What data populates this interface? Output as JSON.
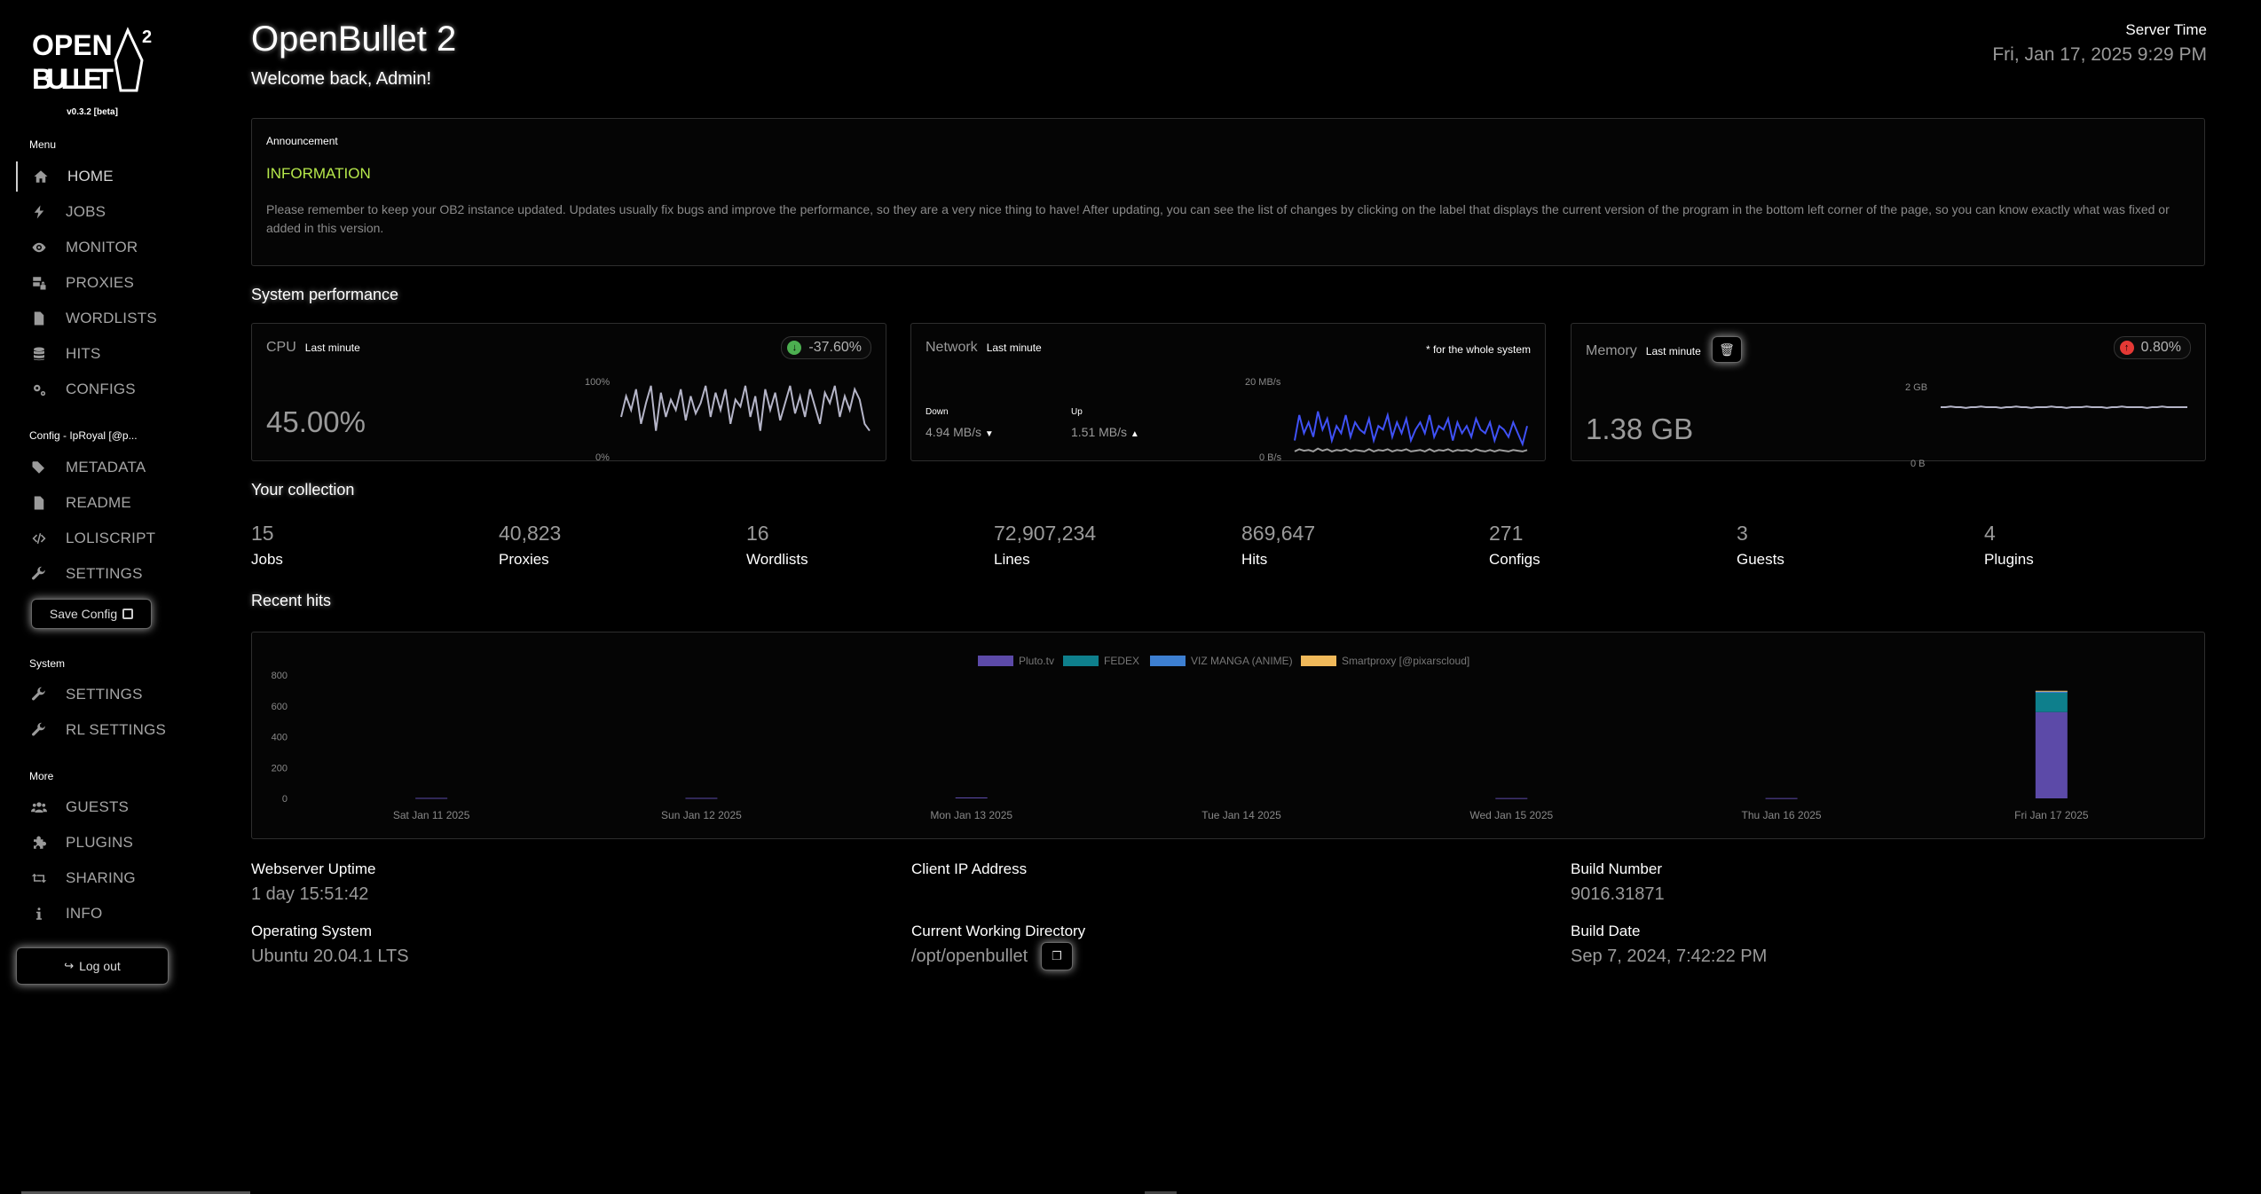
{
  "sidebar": {
    "logo_text": [
      "OPEN",
      "BULLET",
      "2"
    ],
    "version": "v0.3.2 [beta]",
    "menu_title": "Menu",
    "menu": [
      {
        "label": "HOME",
        "icon": "home-icon"
      },
      {
        "label": "JOBS",
        "icon": "bolt-icon"
      },
      {
        "label": "MONITOR",
        "icon": "eye-icon"
      },
      {
        "label": "PROXIES",
        "icon": "server-lock-icon"
      },
      {
        "label": "WORDLISTS",
        "icon": "file-icon"
      },
      {
        "label": "HITS",
        "icon": "database-icon"
      },
      {
        "label": "CONFIGS",
        "icon": "gears-icon"
      }
    ],
    "config_title": "Config - IpRoyal [@p...",
    "config_menu": [
      {
        "label": "METADATA",
        "icon": "tags-icon"
      },
      {
        "label": "README",
        "icon": "file-icon"
      },
      {
        "label": "LOLISCRIPT",
        "icon": "code-icon"
      },
      {
        "label": "SETTINGS",
        "icon": "wrench-icon"
      }
    ],
    "save_config": "Save Config",
    "system_title": "System",
    "system_menu": [
      {
        "label": "SETTINGS",
        "icon": "wrench-icon"
      },
      {
        "label": "RL SETTINGS",
        "icon": "wrench-icon"
      }
    ],
    "more_title": "More",
    "more_menu": [
      {
        "label": "GUESTS",
        "icon": "users-icon"
      },
      {
        "label": "PLUGINS",
        "icon": "puzzle-icon"
      },
      {
        "label": "SHARING",
        "icon": "retweet-icon"
      },
      {
        "label": "INFO",
        "icon": "info-icon"
      }
    ],
    "logout": "Log out"
  },
  "header": {
    "title": "OpenBullet 2",
    "welcome": "Welcome back, Admin!",
    "server_time_label": "Server Time",
    "server_time": "Fri, Jan 17, 2025 9:29 PM"
  },
  "announcement": {
    "label": "Announcement",
    "title": "INFORMATION",
    "text": "Please remember to keep your OB2 instance updated. Updates usually fix bugs and improve the performance, so they are a very nice thing to have! After updating, you can see the list of changes by clicking on the label that displays the current version of the program in the bottom left corner of the page, so you can know exactly what was fixed or added in this version.",
    "title_color": "#b6e84b"
  },
  "performance": {
    "section_title": "System performance",
    "cpu": {
      "title": "CPU",
      "range": "Last minute",
      "value": "45.00%",
      "change": "-37.60%",
      "change_color": "#4caf50",
      "y_max": "100%",
      "y_min": "0%",
      "series": [
        0.5,
        0.8,
        0.6,
        0.9,
        0.4,
        0.7,
        0.95,
        0.3,
        0.85,
        0.5,
        0.75,
        0.6,
        0.9,
        0.45,
        0.8,
        0.55,
        0.7,
        0.95,
        0.5,
        0.85,
        0.6,
        0.9,
        0.4,
        0.75,
        0.65,
        0.95,
        0.5,
        0.8,
        0.3,
        0.9,
        0.6,
        0.85,
        0.45,
        0.7,
        0.95,
        0.55,
        0.8,
        0.5,
        0.9,
        0.65,
        0.4,
        0.85,
        0.7,
        0.95,
        0.5,
        0.8,
        0.6,
        0.9,
        0.75,
        0.4,
        0.3
      ]
    },
    "network": {
      "title": "Network",
      "range": "Last minute",
      "note": "* for the whole system",
      "down_label": "Down",
      "down_value": "4.94 MB/s",
      "up_label": "Up",
      "up_value": "1.51 MB/s",
      "y_max": "20 MB/s",
      "y_min": "0 B/s",
      "down_color": "#3f51f5",
      "up_color": "#9e9e9e",
      "down_series": [
        0.2,
        0.55,
        0.3,
        0.45,
        0.25,
        0.6,
        0.35,
        0.5,
        0.2,
        0.4,
        0.3,
        0.55,
        0.25,
        0.45,
        0.35,
        0.3,
        0.5,
        0.2,
        0.4,
        0.35,
        0.55,
        0.25,
        0.45,
        0.3,
        0.5,
        0.2,
        0.35,
        0.45,
        0.3,
        0.55,
        0.25,
        0.4,
        0.35,
        0.5,
        0.2,
        0.45,
        0.3,
        0.4,
        0.25,
        0.5,
        0.35,
        0.3,
        0.45,
        0.2,
        0.4,
        0.35,
        0.25,
        0.45,
        0.3,
        0.15,
        0.4
      ],
      "up_series": [
        0.05,
        0.08,
        0.06,
        0.07,
        0.05,
        0.09,
        0.06,
        0.08,
        0.05,
        0.07,
        0.06,
        0.08,
        0.05,
        0.07,
        0.06,
        0.05,
        0.08,
        0.05,
        0.07,
        0.06,
        0.08,
        0.05,
        0.07,
        0.06,
        0.08,
        0.05,
        0.06,
        0.07,
        0.05,
        0.08,
        0.05,
        0.07,
        0.06,
        0.08,
        0.05,
        0.07,
        0.06,
        0.07,
        0.05,
        0.08,
        0.06,
        0.05,
        0.07,
        0.05,
        0.07,
        0.06,
        0.05,
        0.07,
        0.06,
        0.05,
        0.07
      ]
    },
    "memory": {
      "title": "Memory",
      "range": "Last minute",
      "value": "1.38 GB",
      "change": "0.80%",
      "change_color": "#e53935",
      "y_max": "2 GB",
      "y_min": "0 B",
      "series": [
        0.69,
        0.69,
        0.7,
        0.69,
        0.69,
        0.68,
        0.69,
        0.69,
        0.7,
        0.69,
        0.69,
        0.69,
        0.68,
        0.69,
        0.69,
        0.7,
        0.69,
        0.69,
        0.68,
        0.69,
        0.69,
        0.69,
        0.7,
        0.69,
        0.69,
        0.68,
        0.69,
        0.69,
        0.69,
        0.7,
        0.69,
        0.69,
        0.69,
        0.68,
        0.69,
        0.69,
        0.7,
        0.69,
        0.69,
        0.69,
        0.69,
        0.68,
        0.69,
        0.69,
        0.7,
        0.69,
        0.69,
        0.69,
        0.69,
        0.69
      ]
    }
  },
  "collection": {
    "section_title": "Your collection",
    "items": [
      {
        "value": "15",
        "label": "Jobs"
      },
      {
        "value": "40,823",
        "label": "Proxies"
      },
      {
        "value": "16",
        "label": "Wordlists"
      },
      {
        "value": "72,907,234",
        "label": "Lines"
      },
      {
        "value": "869,647",
        "label": "Hits"
      },
      {
        "value": "271",
        "label": "Configs"
      },
      {
        "value": "3",
        "label": "Guests"
      },
      {
        "value": "4",
        "label": "Plugins"
      }
    ]
  },
  "recent_hits": {
    "section_title": "Recent hits"
  },
  "chart_data": {
    "type": "bar",
    "stacked": true,
    "categories": [
      "Sat Jan 11 2025",
      "Sun Jan 12 2025",
      "Mon Jan 13 2025",
      "Tue Jan 14 2025",
      "Wed Jan 15 2025",
      "Thu Jan 16 2025",
      "Fri Jan 17 2025"
    ],
    "series": [
      {
        "name": "Pluto.tv",
        "color": "#5c4aa8",
        "values": [
          3,
          3,
          6,
          0,
          2,
          2,
          560
        ]
      },
      {
        "name": "FEDEX",
        "color": "#0e7f8c",
        "values": [
          0,
          0,
          0,
          0,
          0,
          0,
          125
        ]
      },
      {
        "name": "VIZ MANGA (ANIME)",
        "color": "#3d7fd1",
        "values": [
          0,
          0,
          0,
          0,
          0,
          0,
          10
        ]
      },
      {
        "name": "Smartproxy [@pixarscloud]",
        "color": "#f0b95a",
        "values": [
          0,
          0,
          0,
          0,
          0,
          0,
          3
        ]
      }
    ],
    "yticks": [
      "800",
      "600",
      "400",
      "200",
      "0"
    ],
    "ylim": [
      0,
      800
    ],
    "legend": "top-center",
    "grid": false
  },
  "info": {
    "uptime_label": "Webserver Uptime",
    "uptime": "1 day 15:51:42",
    "ip_label": "Client IP Address",
    "ip": "",
    "build_number_label": "Build Number",
    "build_number": "9016.31871",
    "os_label": "Operating System",
    "os": "Ubuntu 20.04.1 LTS",
    "cwd_label": "Current Working Directory",
    "cwd": "/opt/openbullet",
    "build_date_label": "Build Date",
    "build_date": "Sep 7, 2024, 7:42:22 PM"
  }
}
